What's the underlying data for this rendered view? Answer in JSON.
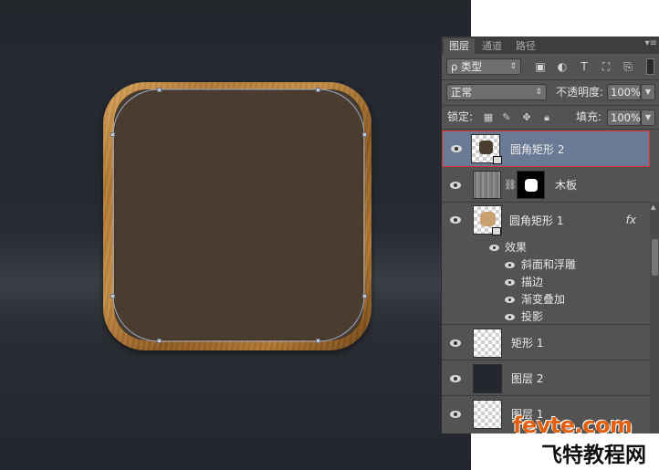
{
  "panel": {
    "tabs": [
      "图层",
      "通道",
      "路径"
    ],
    "menu_glyph": "▾≡",
    "filter": {
      "icon": "search-icon",
      "label": "ρ 类型"
    },
    "blend_mode": "正常",
    "opacity_label": "不透明度:",
    "opacity_value": "100%",
    "lock_label": "锁定:",
    "fill_label": "填充:",
    "fill_value": "100%",
    "filter_icons": [
      "image-icon",
      "adjustment-icon",
      "type-icon",
      "transform-icon",
      "smart-object-icon"
    ],
    "lock_icons": [
      "lock-pixels-icon",
      "lock-paint-icon",
      "lock-position-icon",
      "lock-all-icon"
    ]
  },
  "layers": [
    {
      "name": "圆角矩形 2",
      "selected": true,
      "visible": true
    },
    {
      "name": "木板",
      "selected": false,
      "visible": true
    },
    {
      "name": "圆角矩形 1",
      "selected": false,
      "visible": true,
      "fx": "fx",
      "effects_label": "效果",
      "effects": [
        "斜面和浮雕",
        "描边",
        "渐变叠加",
        "投影"
      ]
    },
    {
      "name": "矩形 1",
      "selected": false,
      "visible": true
    },
    {
      "name": "图层 2",
      "selected": false,
      "visible": true
    },
    {
      "name": "图层 1",
      "selected": false,
      "visible": true
    }
  ],
  "canvas": {
    "icon_inner_color": "#4a3d2f",
    "background_color": "#262a31"
  },
  "watermark": {
    "top": "fevte.com",
    "bottom": "飞特教程网"
  },
  "colors": {
    "selection_border": "#e03030",
    "selected_row": "#6b7a94",
    "panel_bg": "#535353"
  }
}
